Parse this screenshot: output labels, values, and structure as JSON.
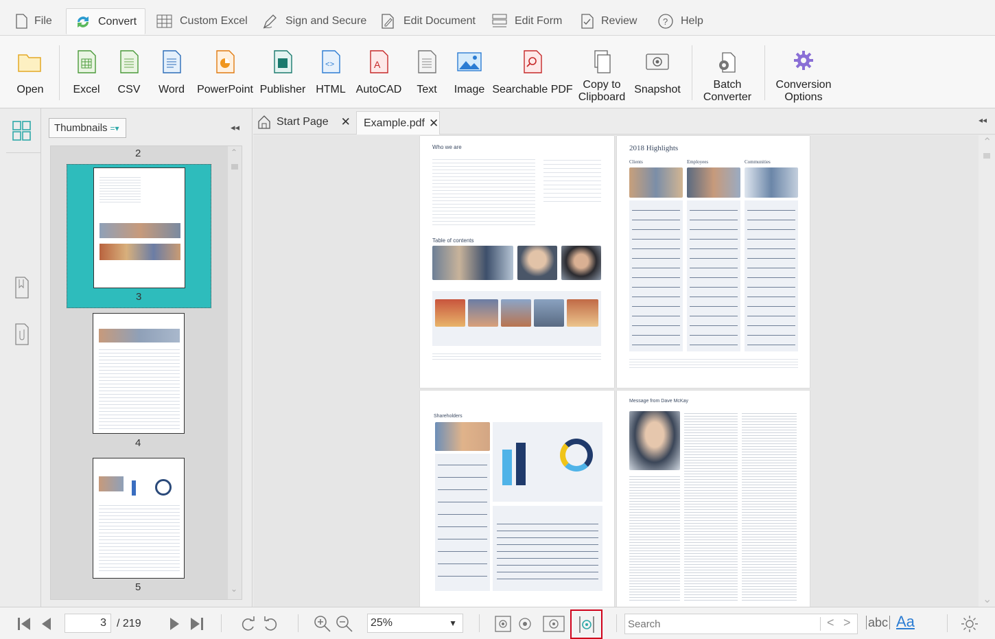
{
  "menu_tabs": [
    {
      "label": "File",
      "icon": "file-icon"
    },
    {
      "label": "Convert",
      "icon": "convert-icon",
      "active": true
    },
    {
      "label": "Custom Excel",
      "icon": "grid-icon"
    },
    {
      "label": "Sign and Secure",
      "icon": "pen-icon"
    },
    {
      "label": "Edit Document",
      "icon": "edit-document-icon"
    },
    {
      "label": "Edit Form",
      "icon": "form-icon"
    },
    {
      "label": "Review",
      "icon": "review-icon"
    },
    {
      "label": "Help",
      "icon": "help-icon"
    }
  ],
  "ribbon": {
    "open": "Open",
    "excel": "Excel",
    "csv": "CSV",
    "word": "Word",
    "powerpoint": "PowerPoint",
    "publisher": "Publisher",
    "html": "HTML",
    "autocad": "AutoCAD",
    "text": "Text",
    "image": "Image",
    "searchable_pdf": "Searchable PDF",
    "copy1": "Copy to",
    "copy2": "Clipboard",
    "snapshot": "Snapshot",
    "batch1": "Batch",
    "batch2": "Converter",
    "conv1": "Conversion",
    "conv2": "Options"
  },
  "thumbnails": {
    "dropdown": "Thumbnails",
    "page_top": "2",
    "pages": [
      "3",
      "4",
      "5"
    ]
  },
  "doc_tabs": {
    "start": "Start Page",
    "example": "Example.pdf"
  },
  "pages": {
    "p1_title": "Who we are",
    "p1_toc": "Table of contents",
    "p2_title": "2018 Highlights",
    "p2_cols": [
      "Clients",
      "Employees",
      "Communities"
    ],
    "p3_title": "Shareholders",
    "p4_title": "Message from Dave McKay"
  },
  "status": {
    "page": "3",
    "total": "/ 219",
    "zoom": "25%",
    "search_placeholder": "Search"
  },
  "colors": {
    "accent": "#2ea8a8",
    "highlight": "#d0021b",
    "ribbon_blue": "#2b7cd3"
  }
}
